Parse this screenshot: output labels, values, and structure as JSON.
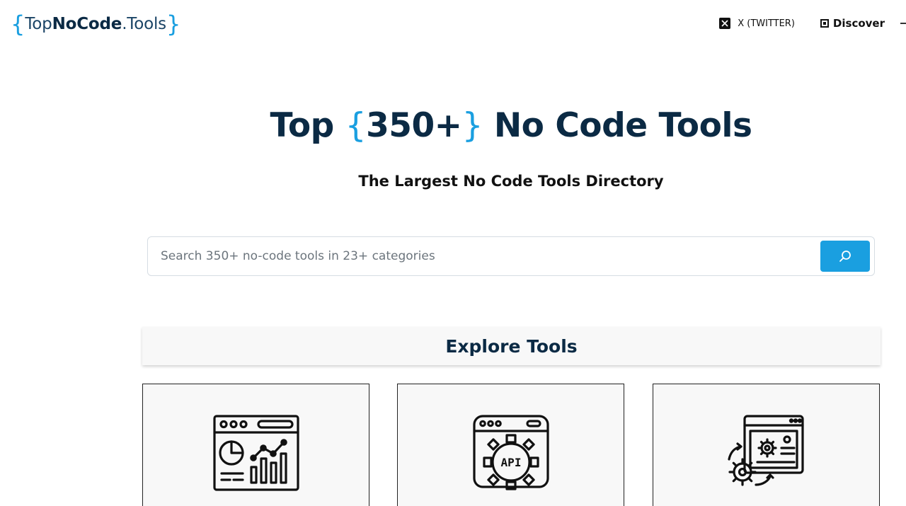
{
  "header": {
    "logo": {
      "brace_open": "{",
      "part_a": "Top",
      "part_b": "NoCode",
      "part_c": ".Tools",
      "brace_close": "}"
    },
    "nav": {
      "twitter_label": "X (TWITTER)",
      "discover_label": "Discover"
    }
  },
  "hero": {
    "title_before": "Top ",
    "brace_open": "{",
    "title_count": "350+",
    "brace_close": "}",
    "title_after": " No Code Tools",
    "subtitle": "The Largest No Code Tools Directory"
  },
  "search": {
    "placeholder": "Search 350+ no-code tools in 23+ categories",
    "value": ""
  },
  "explore": {
    "heading": "Explore Tools"
  },
  "cards": [
    {
      "icon": "analytics-dashboard-icon"
    },
    {
      "icon": "api-gear-icon"
    },
    {
      "icon": "automation-settings-icon"
    }
  ],
  "colors": {
    "accent": "#1a9fe0",
    "navy": "#0b2a44",
    "card_bg": "#f8f8f8"
  }
}
